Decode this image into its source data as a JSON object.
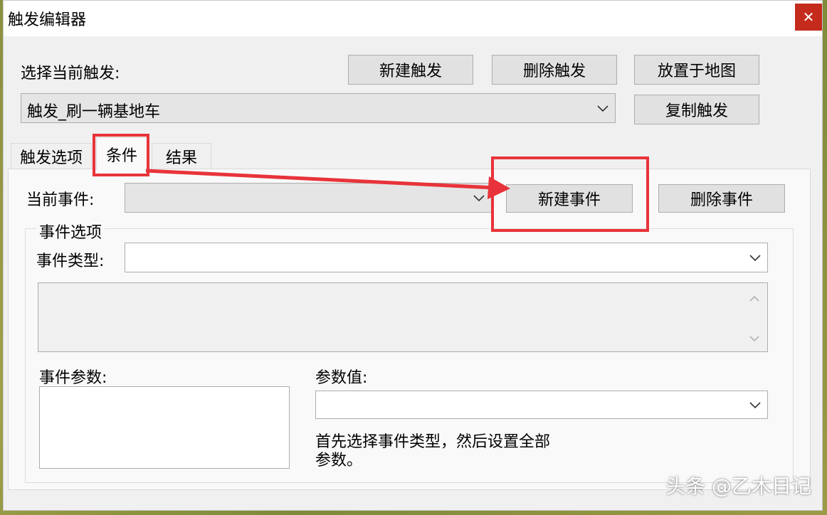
{
  "window": {
    "title": "触发编辑器",
    "close_glyph": "✕"
  },
  "trigger": {
    "select_label": "选择当前触发:",
    "new_button": "新建触发",
    "delete_button": "删除触发",
    "place_button": "放置于地图",
    "copy_button": "复制触发",
    "selected": "触发_刷一辆基地车"
  },
  "tabs": [
    {
      "label": "触发选项"
    },
    {
      "label": "条件"
    },
    {
      "label": "结果"
    }
  ],
  "event": {
    "current_label": "当前事件:",
    "current_value": "",
    "new_button": "新建事件",
    "delete_button": "删除事件",
    "options_group": "事件选项",
    "type_label": "事件类型:",
    "type_value": "",
    "params_label": "事件参数:",
    "param_value_label": "参数值:",
    "param_value": "",
    "hint_line1": "首先选择事件类型，然后设置全部",
    "hint_line2": "参数。"
  },
  "colors": {
    "highlight_red": "#e8333a",
    "close_red": "#c42b1c"
  },
  "watermark": "头条 @乙木日记"
}
